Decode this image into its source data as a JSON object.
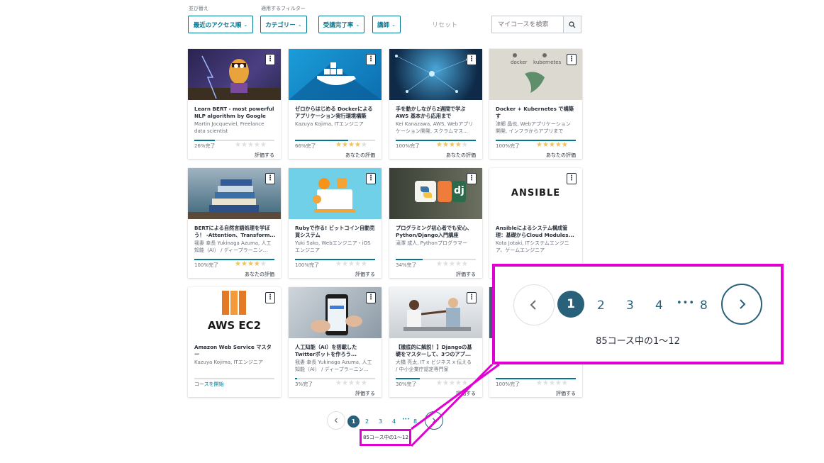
{
  "filters": {
    "sort_label": "並び替え",
    "filter_label": "適用するフィルター",
    "sort_button": "最近のアクセス順",
    "category_button": "カテゴリー",
    "progress_button": "受講完了率",
    "instructor_button": "講師",
    "reset": "リセット",
    "search_placeholder": "マイコースを検索"
  },
  "courses": [
    {
      "title": "Learn BERT - most powerful\nNLP algorithm by Google",
      "instructor": "Martin Jocqueviel, Freelance\ndata scientist",
      "progress_text": "26%完了",
      "progress": 0.26,
      "stars": 0,
      "rating_label": "評価する"
    },
    {
      "title": "ゼロからはじめる Dockerによる\nアプリケーション実行環境構築",
      "instructor": "Kazuya Kojima, ITエンジニア",
      "progress_text": "66%完了",
      "progress": 0.66,
      "stars": 4,
      "rating_label": "あなたの評価"
    },
    {
      "title": "手を動かしながら2週間で学ぶ\nAWS 基本から応用まで",
      "instructor": "Kei Kanazawa, AWS, Webアプリ\nケーション開発, スクラムマス...",
      "progress_text": "100%完了",
      "progress": 1.0,
      "stars": 4,
      "rating_label": "あなたの評価"
    },
    {
      "title": "Docker + Kubernetes で構築す\nる Webアプリケーション 実践...",
      "instructor": "津郷 晶也, Webアプリケーション\n開発, インフラからアプリまで",
      "progress_text": "100%完了",
      "progress": 1.0,
      "stars": 4.5,
      "rating_label": "あなたの評価"
    },
    {
      "title": "BERTによる自然言語処理を学ぼ\nう！ -Attention、Transform...",
      "instructor": "我妻 幸長 Yukinaga Azuma, 人工\n知能（AI） / ディープラーニン...",
      "progress_text": "100%完了",
      "progress": 1.0,
      "stars": 4,
      "rating_label": "あなたの評価"
    },
    {
      "title": "Rubyで作る! ビットコイン自動売\n買システム",
      "instructor": "Yuki Sako, Webエンジニア・iOS\nエンジニア",
      "progress_text": "100%完了",
      "progress": 1.0,
      "stars": 0,
      "rating_label": "評価する"
    },
    {
      "title": "プログラミング初心者でも安心、\nPython/Django入門講座",
      "instructor": "滝澤 成人, Pythonプログラマー",
      "progress_text": "34%完了",
      "progress": 0.34,
      "stars": 0,
      "rating_label": "評価する"
    },
    {
      "title": "Ansibleによるシステム構成管\n理：基礎からCloud Modules...",
      "instructor": "Kota Jotaki, ITシステムエンジニ\nア、ゲームエンジニア",
      "progress_text": "",
      "progress": 0,
      "stars": 0,
      "rating_label": ""
    },
    {
      "title": "Amazon Web Service マスター\nコース EC2編",
      "instructor": "Kazuya Kojima, ITエンジニア",
      "progress_text": "",
      "progress": 0,
      "stars": 0,
      "rating_label": "",
      "start_label": "コースを開始"
    },
    {
      "title": "人工知能（AI）を搭載した\nTwitterボットを作ろう...",
      "instructor": "我妻 幸長 Yukinaga Azuma, 人工\n知能（AI） / ディープラーニン...",
      "progress_text": "3%完了",
      "progress": 0.03,
      "stars": 0,
      "rating_label": "評価する"
    },
    {
      "title": "【徹底的に解説！】Djangoの基\n礎をマスターして、3つのアプ...",
      "instructor": "大橋 亮太, IT x ビジネス x 伝える\n/ 中小企業庁認定専門家",
      "progress_text": "30%完了",
      "progress": 0.3,
      "stars": 0,
      "rating_label": "評価する"
    },
    {
      "title": "",
      "instructor": "",
      "progress_text": "100%完了",
      "progress": 1.0,
      "stars": 0,
      "rating_label": "評価する"
    }
  ],
  "thumb_texts": {
    "docker": "docker",
    "kubernetes": "kubernetes",
    "ansible": "ANSIBLE",
    "aws_ec2": "AWS EC2",
    "django_dj": "dj"
  },
  "kebab": "⋮",
  "pagination": {
    "pages": [
      "1",
      "2",
      "3",
      "4",
      "8"
    ],
    "dots": "•••",
    "count_text": "85コース中の1〜12"
  },
  "colors": {
    "accent": "#007791",
    "active_page": "#29607a",
    "star": "#f4c150",
    "highlight": "#e100d1"
  }
}
